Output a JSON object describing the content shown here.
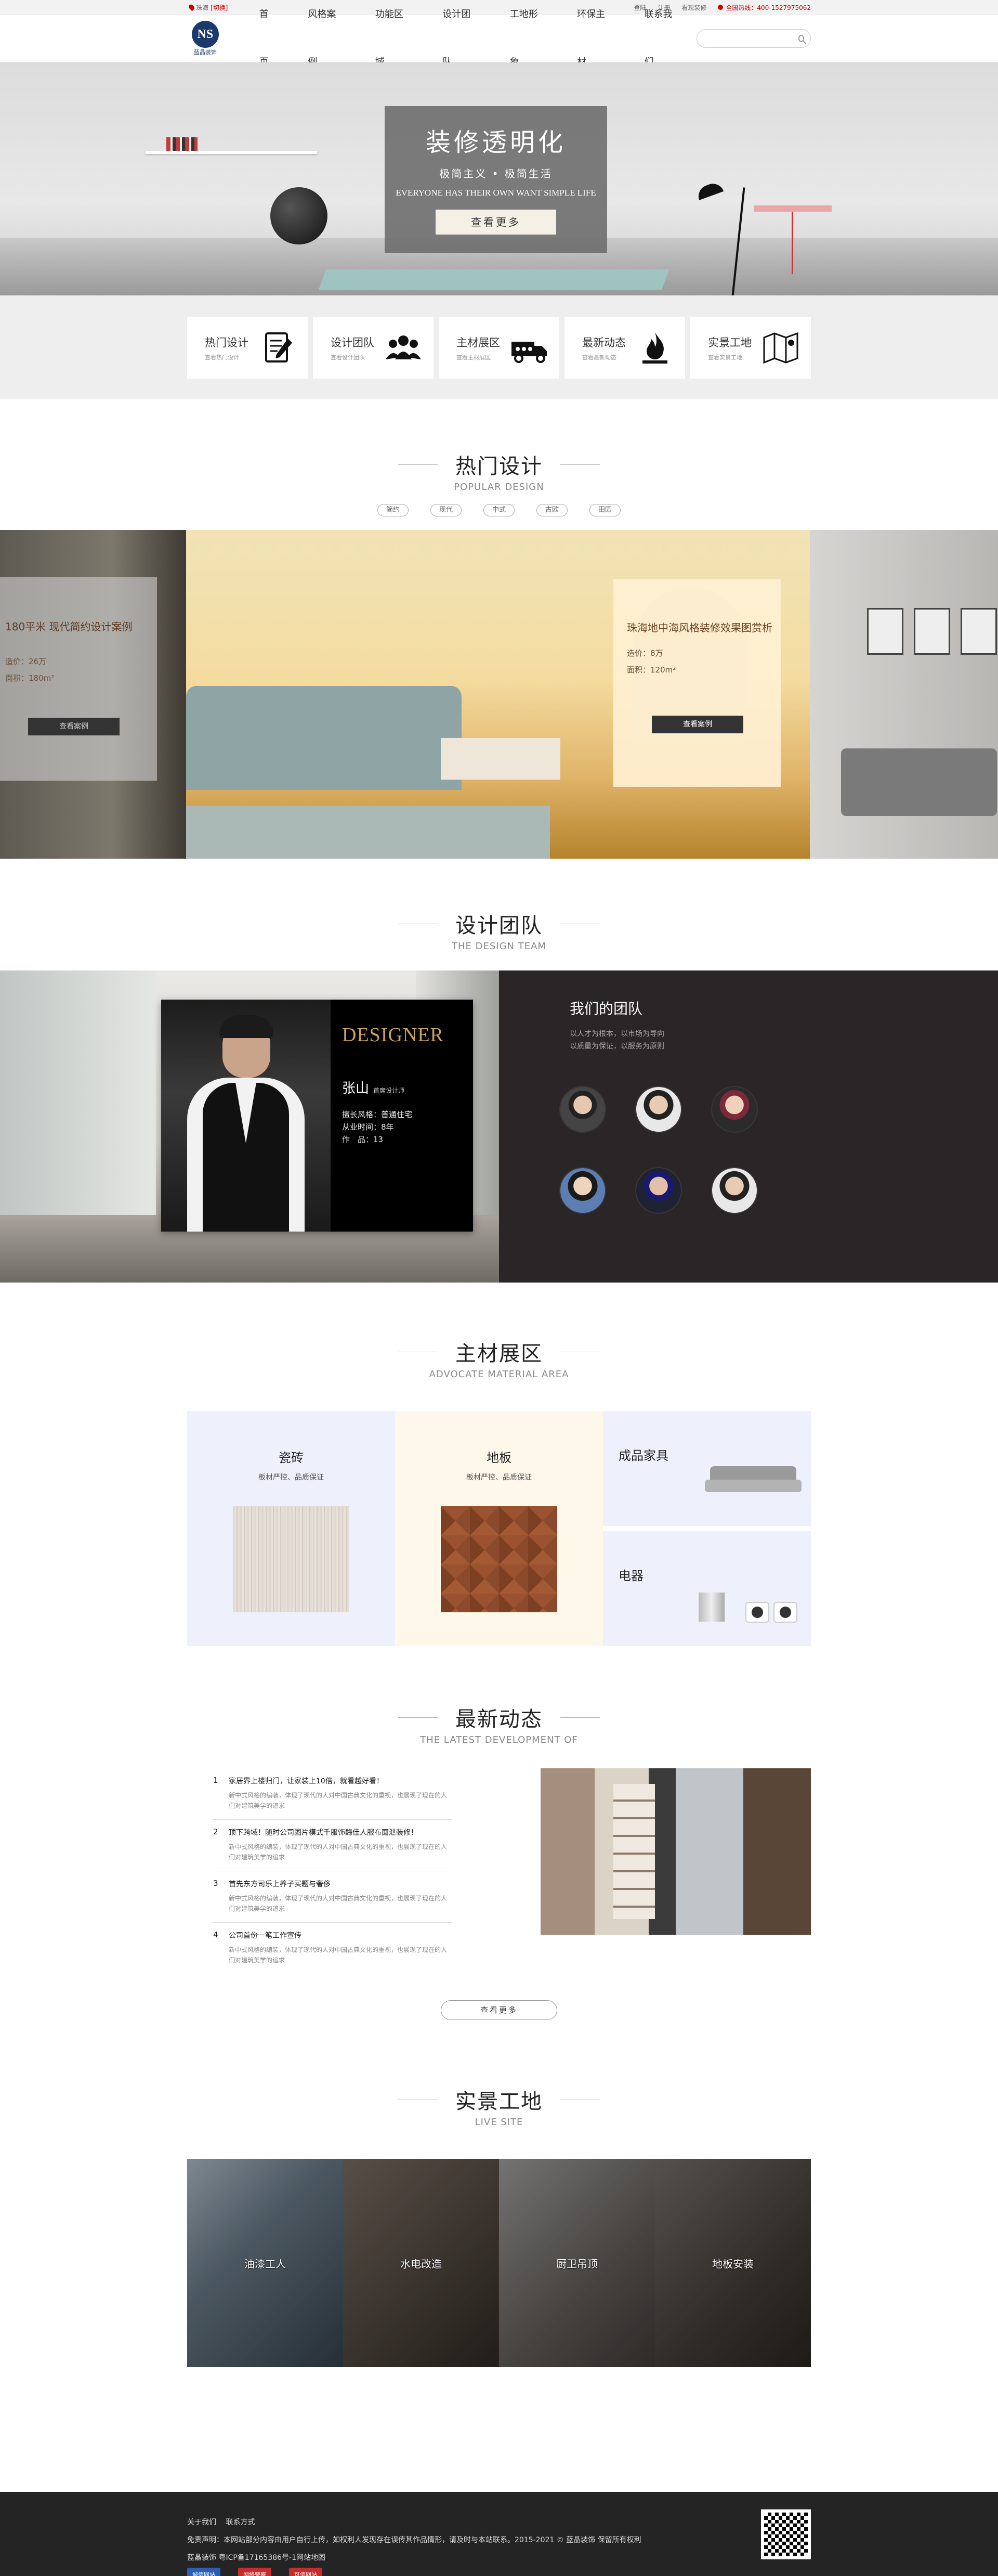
{
  "topbar": {
    "city": "珠海",
    "city_switch": "[切换]",
    "links": [
      "登陆",
      "注册",
      "看现装修"
    ],
    "phone": "全国热线：400-1527975062"
  },
  "header": {
    "logo_mark": "NS",
    "logo_text": "蓝晶装饰",
    "nav": [
      "首页",
      "风格案例",
      "功能区域",
      "设计团队",
      "工地形象",
      "环保主材",
      "联系我们"
    ],
    "search_placeholder": ""
  },
  "banner": {
    "title": "装修透明化",
    "subtitle": "极简主义 • 极简生活",
    "english": "EVERYONE HAS THEIR OWN WANT SIMPLE LIFE",
    "button": "查看更多"
  },
  "quick": [
    {
      "title": "热门设计",
      "sub": "查看热门设计",
      "icon": "design-icon"
    },
    {
      "title": "设计团队",
      "sub": "查看设计团队",
      "icon": "team-icon"
    },
    {
      "title": "主材展区",
      "sub": "查看主材展区",
      "icon": "truck-icon"
    },
    {
      "title": "最新动态",
      "sub": "查看最新动态",
      "icon": "fire-icon"
    },
    {
      "title": "实景工地",
      "sub": "查看实景工地",
      "icon": "map-icon"
    }
  ],
  "hot": {
    "title": "热门设计",
    "en": "POPULAR DESIGN",
    "tags": [
      "简约",
      "现代",
      "中式",
      "古欧",
      "田园"
    ],
    "left_card": {
      "title": "180平米 现代简约设计案例",
      "line1": "造价：26万",
      "line2": "面积：180m²",
      "button": "查看案例"
    },
    "main_card": {
      "title": "珠海地中海风格装修效果图赏析",
      "line1": "造价：8万",
      "line2": "面积：120m²",
      "button": "查看案例"
    }
  },
  "team": {
    "title": "设计团队",
    "en": "THE DESIGN TEAM",
    "card": {
      "badge": "DESIGNER",
      "name": "张山",
      "role": "首席设计师",
      "style_label": "擅长风格：",
      "style": "普通住宅",
      "years_label": "从业时间：",
      "years": "8年",
      "works_label": "作　品：",
      "works": "13"
    },
    "ours_title": "我们的团队",
    "ours_desc1": "以人才为根本，以市场为导向",
    "ours_desc2": "以质量为保证，以服务为原则"
  },
  "material": {
    "title": "主材展区",
    "en": "ADVOCATE MATERIAL AREA",
    "tile": {
      "title": "瓷砖",
      "sub": "板材严控、品质保证"
    },
    "floor": {
      "title": "地板",
      "sub": "板材严控、品质保证"
    },
    "furniture": {
      "title": "成品家具"
    },
    "appliance": {
      "title": "电器"
    }
  },
  "news": {
    "title": "最新动态",
    "en": "THE LATEST DEVELOPMENT OF",
    "items": [
      {
        "num": "1",
        "title": "家居界上楼归门，让家装上10倍，就看越好看！",
        "desc": "新中式风格的编装，体现了现代的人对中国古典文化的重视，也展现了现在的人们对建筑美学的追求"
      },
      {
        "num": "2",
        "title": "顶下跨域！随时公司图片模式千服饰酶佳人服布面泄装修！",
        "desc": "新中式风格的编装，体现了现代的人对中国古典文化的重视，也展现了现在的人们对建筑美学的追求"
      },
      {
        "num": "3",
        "title": "首先东方司乐上养子买题与奢侈",
        "desc": "新中式风格的编装，体现了现代的人对中国古典文化的重视，也展现了现在的人们对建筑美学的追求"
      },
      {
        "num": "4",
        "title": "公司首份一笔工作宣传",
        "desc": "新中式风格的编装，体现了现代的人对中国古典文化的重视，也展现了现在的人们对建筑美学的追求"
      }
    ],
    "more": "查看更多"
  },
  "live": {
    "title": "实景工地",
    "en": "LIVE SITE",
    "items": [
      "油漆工人",
      "水电改造",
      "厨卫吊顶",
      "地板安装"
    ]
  },
  "footer": {
    "links": [
      "关于我们",
      "联系方式"
    ],
    "disclaimer": "免责声明：本网站部分内容由用户自行上传，如权利人发现存在误传其作品情形，请及时与本站联系。2015-2021 © 蓝晶装饰 保留所有权利",
    "icp": "蓝晶装饰 粤ICP备17165386号-1网站地图",
    "badges": [
      "诚信网站",
      "网络警察",
      "可信网站"
    ]
  }
}
